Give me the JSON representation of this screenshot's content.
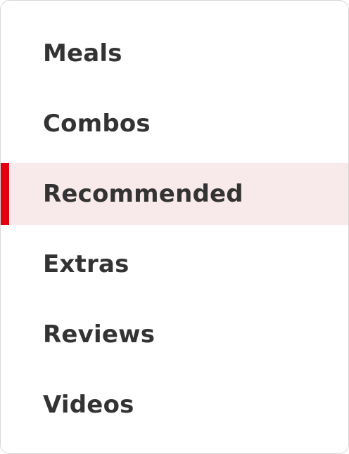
{
  "menu": {
    "items": [
      {
        "label": "Meals"
      },
      {
        "label": "Combos"
      },
      {
        "label": "Recommended"
      },
      {
        "label": "Extras"
      },
      {
        "label": "Reviews"
      },
      {
        "label": "Videos"
      }
    ],
    "active_index": 2,
    "colors": {
      "accent": "#e0000f",
      "active_background": "#f8e9ea",
      "text": "#333333"
    }
  }
}
